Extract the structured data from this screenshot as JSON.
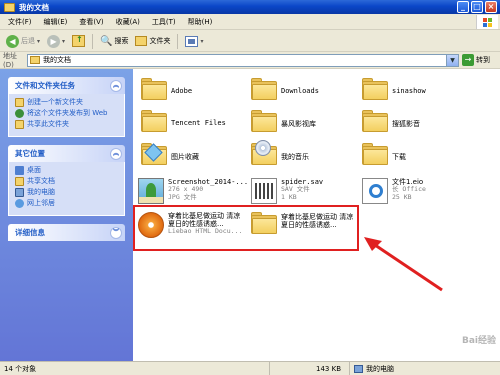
{
  "window": {
    "title": "我的文档",
    "minimize": "_",
    "maximize": "□",
    "close": "×"
  },
  "menu": [
    "文件(F)",
    "编辑(E)",
    "查看(V)",
    "收藏(A)",
    "工具(T)",
    "帮助(H)"
  ],
  "toolbar": {
    "back": "后退",
    "search": "搜索",
    "folders": "文件夹"
  },
  "address": {
    "label": "地址(D)",
    "value": "我的文档",
    "go": "转到"
  },
  "sidebar": {
    "file_tasks": {
      "title": "文件和文件夹任务",
      "items": [
        "创建一个新文件夹",
        "将这个文件夹发布到 Web",
        "共享此文件夹"
      ]
    },
    "other_places": {
      "title": "其它位置",
      "items": [
        "桌面",
        "共享文档",
        "我的电脑",
        "网上邻居"
      ]
    },
    "details": {
      "title": "详细信息"
    }
  },
  "files": [
    {
      "name": "Adobe",
      "type": "folder"
    },
    {
      "name": "Downloads",
      "type": "folder"
    },
    {
      "name": "sinashow",
      "type": "folder"
    },
    {
      "name": "Tencent Files",
      "type": "folder"
    },
    {
      "name": "暴风影视库",
      "type": "folder"
    },
    {
      "name": "搜狐影音",
      "type": "folder"
    },
    {
      "name": "图片收藏",
      "type": "folder-pictures"
    },
    {
      "name": "我的音乐",
      "type": "folder-music"
    },
    {
      "name": "下载",
      "type": "folder"
    },
    {
      "name": "Screenshot_2014-...",
      "line2": "276 x 490",
      "line3": "JPG 文件",
      "type": "image"
    },
    {
      "name": "spider.sav",
      "line2": "SAV 文件",
      "line3": "1 KB",
      "type": "sav"
    },
    {
      "name": "文件1.eio",
      "line2": "长 Office",
      "line3": "25 KB",
      "type": "eio"
    },
    {
      "name": "穿着比基尼做运动 清凉夏日的性感诱惑...",
      "line3": "Liebao HTML Docu...",
      "type": "html"
    },
    {
      "name": "穿着比基尼做运动 清凉夏日的性感诱惑...",
      "type": "folder"
    }
  ],
  "status": {
    "objects": "14 个对象",
    "size": "143 KB",
    "location": "我的电脑"
  },
  "watermark": "Bai经验"
}
